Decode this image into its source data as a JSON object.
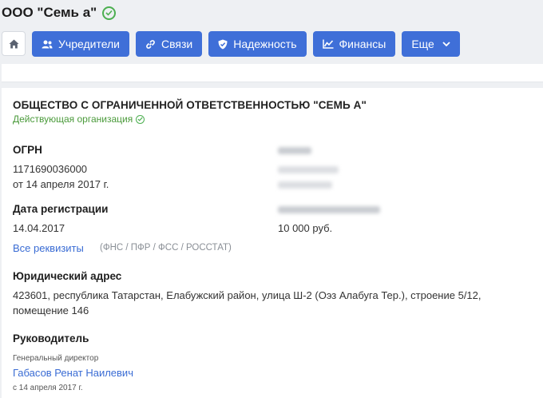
{
  "company": {
    "short_title": "ООО \"Семь а\"",
    "full_name": "ОБЩЕСТВО С ОГРАНИЧЕННОЙ ОТВЕТСТВЕННОСТЬЮ \"СЕМЬ А\"",
    "status": "Действующая организация"
  },
  "nav": {
    "home_icon": "home-icon",
    "buttons": [
      {
        "label": "Учредители",
        "icon": "users-icon"
      },
      {
        "label": "Связи",
        "icon": "link-icon"
      },
      {
        "label": "Надежность",
        "icon": "shield-check-icon"
      },
      {
        "label": "Финансы",
        "icon": "chart-icon"
      }
    ],
    "more_label": "Еще",
    "accent_color": "#3f6fd8"
  },
  "details": {
    "ogrn_label": "ОГРН",
    "ogrn_value": "1171690036000",
    "ogrn_date": "от 14 апреля 2017 г.",
    "reg_date_label": "Дата регистрации",
    "reg_date_value": "14.04.2017",
    "capital_value": "10 000 руб.",
    "requisites_link": "Все реквизиты",
    "requisites_sources": "(ФНС / ПФР / ФСС / РОССТАТ)"
  },
  "address": {
    "label": "Юридический адрес",
    "line1": "423601, республика Татарстан, Елабужский район, улица Ш-2 (Оэз Алабуга Тер.), строение 5/12,",
    "line2": "помещение 146"
  },
  "head": {
    "label": "Руководитель",
    "position": "Генеральный директор",
    "name": "Габасов Ренат Наилевич",
    "since": "с 14 апреля 2017 г."
  }
}
